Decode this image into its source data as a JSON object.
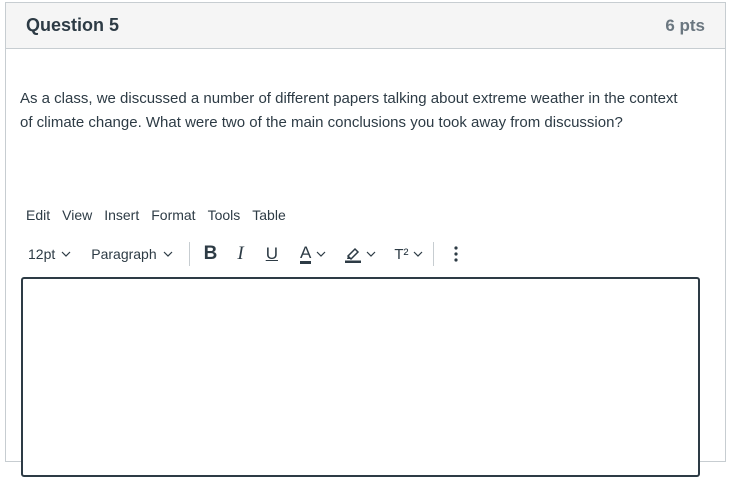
{
  "question": {
    "title": "Question 5",
    "points": "6 pts",
    "text": "As a class, we discussed a number of different papers talking about extreme weather in the context of climate change. What were two of the main conclusions you took away from discussion?"
  },
  "editor": {
    "menu": [
      "Edit",
      "View",
      "Insert",
      "Format",
      "Tools",
      "Table"
    ],
    "font_size": "12pt",
    "block_format": "Paragraph",
    "buttons": {
      "bold": "B",
      "italic": "I",
      "underline": "U",
      "text_color": "A",
      "superscript": "T²"
    },
    "content": ""
  },
  "colors": {
    "text": "#2d3b45",
    "border": "#c7cdd1",
    "header_bg": "#f5f5f5",
    "muted": "#6b7780"
  },
  "icons": [
    "chevron-down-icon",
    "highlighter-icon",
    "more-vertical-icon"
  ]
}
